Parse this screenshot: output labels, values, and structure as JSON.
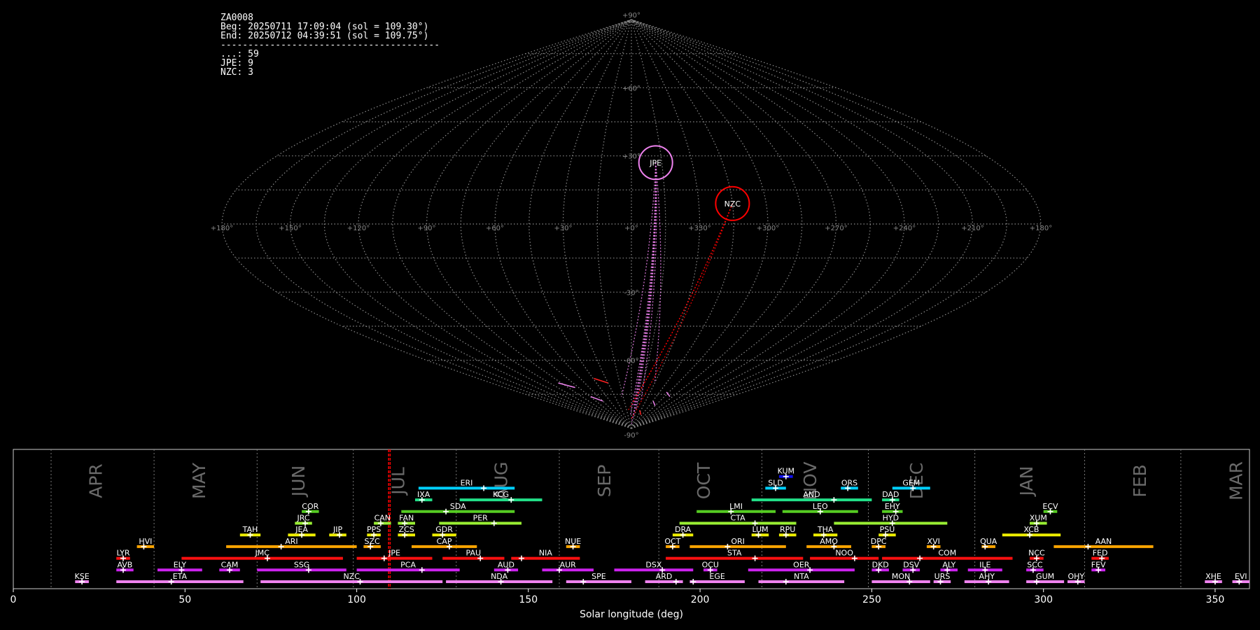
{
  "info_box": {
    "lines": [
      "ZA0008",
      "Beg: 20250711 17:09:04 (sol = 109.30°)",
      "End: 20250712 04:39:51 (sol = 109.75°)",
      "----------------------------------------",
      "...: 59",
      "JPE: 9",
      "NZC: 3"
    ]
  },
  "sky_map": {
    "projection": "sinusoidal",
    "lon_labels": [
      "+180°",
      "+150°",
      "+120°",
      "+90°",
      "+60°",
      "+30°",
      "+0°",
      "+330°",
      "+300°",
      "+270°",
      "+240°",
      "+210°",
      "+180°"
    ],
    "lat_labels": [
      "+90°",
      "+60°",
      "+30°",
      "-30°",
      "-60°",
      "-90°"
    ],
    "radiants": [
      {
        "name": "JPE",
        "color": "#ee82ee",
        "lon": -12,
        "lat": 27
      },
      {
        "name": "NZC",
        "color": "#ff0000",
        "lon": -45,
        "lat": 9
      }
    ]
  },
  "chart_data": {
    "type": "timeline",
    "xlabel": "Solar longitude (deg)",
    "xlim": [
      0,
      360
    ],
    "xticks": [
      0,
      50,
      100,
      150,
      200,
      250,
      300,
      350
    ],
    "months": [
      {
        "label": "APR",
        "boundary": 11,
        "center": 24
      },
      {
        "label": "MAY",
        "boundary": 41,
        "center": 54
      },
      {
        "label": "JUN",
        "boundary": 71,
        "center": 83
      },
      {
        "label": "JUL",
        "boundary": 99,
        "center": 112
      },
      {
        "label": "AUG",
        "boundary": 129,
        "center": 142
      },
      {
        "label": "SEP",
        "boundary": 159,
        "center": 172
      },
      {
        "label": "OCT",
        "boundary": 188,
        "center": 201
      },
      {
        "label": "NOV",
        "boundary": 218,
        "center": 232
      },
      {
        "label": "DEC",
        "boundary": 249,
        "center": 263
      },
      {
        "label": "JAN",
        "boundary": 280,
        "center": 295
      },
      {
        "label": "FEB",
        "boundary": 312,
        "center": 328
      },
      {
        "label": "MAR",
        "boundary": 340,
        "center": 356
      }
    ],
    "current": [
      109.3,
      109.75
    ],
    "showers": [
      {
        "name": "KUM",
        "start": 223,
        "end": 227,
        "peak": 225,
        "row": 9,
        "color": "#1010ee"
      },
      {
        "name": "ERI",
        "start": 118,
        "end": 146,
        "peak": 137,
        "row": 8,
        "color": "#00d0ff"
      },
      {
        "name": "SLD",
        "start": 219,
        "end": 225,
        "peak": 222,
        "row": 8,
        "color": "#00d0ff"
      },
      {
        "name": "ORS",
        "start": 241,
        "end": 246,
        "peak": 243,
        "row": 8,
        "color": "#00d0ff"
      },
      {
        "name": "GEM",
        "start": 256,
        "end": 267,
        "peak": 262,
        "row": 8,
        "color": "#00d0ff"
      },
      {
        "name": "IXA",
        "start": 117,
        "end": 122,
        "peak": 119,
        "row": 7,
        "color": "#22e088"
      },
      {
        "name": "KCG",
        "start": 130,
        "end": 154,
        "peak": 145,
        "row": 7,
        "color": "#22e088"
      },
      {
        "name": "AND",
        "start": 215,
        "end": 250,
        "peak": 239,
        "row": 7,
        "color": "#22e088"
      },
      {
        "name": "DAD",
        "start": 253,
        "end": 258,
        "peak": 256,
        "row": 7,
        "color": "#22e088"
      },
      {
        "name": "COR",
        "start": 84,
        "end": 89,
        "peak": 86,
        "row": 6,
        "color": "#55cc22"
      },
      {
        "name": "SDA",
        "start": 113,
        "end": 146,
        "peak": 126,
        "row": 6,
        "color": "#55cc22"
      },
      {
        "name": "LMI",
        "start": 199,
        "end": 222,
        "peak": 209,
        "row": 6,
        "color": "#55cc22"
      },
      {
        "name": "LEO",
        "start": 224,
        "end": 246,
        "peak": 235,
        "row": 6,
        "color": "#55cc22"
      },
      {
        "name": "EHY",
        "start": 253,
        "end": 259,
        "peak": 257,
        "row": 6,
        "color": "#55cc22"
      },
      {
        "name": "ECV",
        "start": 300,
        "end": 304,
        "peak": 302,
        "row": 6,
        "color": "#55cc22"
      },
      {
        "name": "JRC",
        "start": 82,
        "end": 87,
        "peak": 85,
        "row": 5,
        "color": "#99ee33"
      },
      {
        "name": "CAN",
        "start": 105,
        "end": 110,
        "peak": 107,
        "row": 5,
        "color": "#99ee33"
      },
      {
        "name": "FAN",
        "start": 112,
        "end": 117,
        "peak": 114,
        "row": 5,
        "color": "#99ee33"
      },
      {
        "name": "PER",
        "start": 124,
        "end": 148,
        "peak": 140,
        "row": 5,
        "color": "#99ee33"
      },
      {
        "name": "CTA",
        "start": 194,
        "end": 228,
        "peak": 216,
        "row": 5,
        "color": "#99ee33"
      },
      {
        "name": "HYD",
        "start": 239,
        "end": 272,
        "peak": 256,
        "row": 5,
        "color": "#99ee33"
      },
      {
        "name": "XUM",
        "start": 296,
        "end": 301,
        "peak": 298,
        "row": 5,
        "color": "#99ee33"
      },
      {
        "name": "TAH",
        "start": 66,
        "end": 72,
        "peak": 69,
        "row": 4,
        "color": "#eeee00"
      },
      {
        "name": "JEA",
        "start": 80,
        "end": 88,
        "peak": 84,
        "row": 4,
        "color": "#eeee00"
      },
      {
        "name": "JIP",
        "start": 92,
        "end": 97,
        "peak": 95,
        "row": 4,
        "color": "#eeee00"
      },
      {
        "name": "PPS",
        "start": 103,
        "end": 107,
        "peak": 105,
        "row": 4,
        "color": "#eeee00"
      },
      {
        "name": "ZCS",
        "start": 112,
        "end": 117,
        "peak": 114,
        "row": 4,
        "color": "#eeee00"
      },
      {
        "name": "GDR",
        "start": 122,
        "end": 129,
        "peak": 125,
        "row": 4,
        "color": "#eeee00"
      },
      {
        "name": "DRA",
        "start": 192,
        "end": 198,
        "peak": 195,
        "row": 4,
        "color": "#eeee00"
      },
      {
        "name": "LUM",
        "start": 215,
        "end": 220,
        "peak": 217,
        "row": 4,
        "color": "#eeee00"
      },
      {
        "name": "RPU",
        "start": 223,
        "end": 228,
        "peak": 225,
        "row": 4,
        "color": "#eeee00"
      },
      {
        "name": "THA",
        "start": 233,
        "end": 240,
        "peak": 236,
        "row": 4,
        "color": "#eeee00"
      },
      {
        "name": "PSU",
        "start": 252,
        "end": 257,
        "peak": 254,
        "row": 4,
        "color": "#eeee00"
      },
      {
        "name": "XCB",
        "start": 288,
        "end": 305,
        "peak": 296,
        "row": 4,
        "color": "#eeee00"
      },
      {
        "name": "HVI",
        "start": 36,
        "end": 41,
        "peak": 38,
        "row": 3,
        "color": "#ffa500"
      },
      {
        "name": "ARI",
        "start": 62,
        "end": 100,
        "peak": 78,
        "row": 3,
        "color": "#ffa500"
      },
      {
        "name": "SZC",
        "start": 102,
        "end": 107,
        "peak": 104,
        "row": 3,
        "color": "#ffa500"
      },
      {
        "name": "CAP",
        "start": 116,
        "end": 135,
        "peak": 127,
        "row": 3,
        "color": "#ffa500"
      },
      {
        "name": "NUE",
        "start": 161,
        "end": 165,
        "peak": 163,
        "row": 3,
        "color": "#ffa500"
      },
      {
        "name": "OCT",
        "start": 190,
        "end": 194,
        "peak": 192,
        "row": 3,
        "color": "#ffa500"
      },
      {
        "name": "ORI",
        "start": 197,
        "end": 225,
        "peak": 208,
        "row": 3,
        "color": "#ffa500"
      },
      {
        "name": "AMO",
        "start": 231,
        "end": 244,
        "peak": 239,
        "row": 3,
        "color": "#ffa500"
      },
      {
        "name": "DPC",
        "start": 250,
        "end": 254,
        "peak": 252,
        "row": 3,
        "color": "#ffa500"
      },
      {
        "name": "XVI",
        "start": 266,
        "end": 270,
        "peak": 268,
        "row": 3,
        "color": "#ffa500"
      },
      {
        "name": "QUA",
        "start": 282,
        "end": 286,
        "peak": 283,
        "row": 3,
        "color": "#ffa500"
      },
      {
        "name": "AAN",
        "start": 303,
        "end": 332,
        "peak": 313,
        "row": 3,
        "color": "#ffa500"
      },
      {
        "name": "LYR",
        "start": 30,
        "end": 34,
        "peak": 32,
        "row": 2,
        "color": "#ff1010"
      },
      {
        "name": "JMC",
        "start": 49,
        "end": 96,
        "peak": 74,
        "row": 2,
        "color": "#ff1010"
      },
      {
        "name": "JPE",
        "start": 100,
        "end": 122,
        "peak": 108,
        "row": 2,
        "color": "#ff1010"
      },
      {
        "name": "PAU",
        "start": 125,
        "end": 143,
        "peak": 136,
        "row": 2,
        "color": "#ff1010"
      },
      {
        "name": "NIA",
        "start": 145,
        "end": 165,
        "peak": 148,
        "row": 2,
        "color": "#ff1010"
      },
      {
        "name": "STA",
        "start": 190,
        "end": 230,
        "peak": 216,
        "row": 2,
        "color": "#ff1010"
      },
      {
        "name": "NOO",
        "start": 232,
        "end": 252,
        "peak": 245,
        "row": 2,
        "color": "#ff1010"
      },
      {
        "name": "COM",
        "start": 253,
        "end": 291,
        "peak": 264,
        "row": 2,
        "color": "#ff1010"
      },
      {
        "name": "NCC",
        "start": 296,
        "end": 300,
        "peak": 298,
        "row": 2,
        "color": "#ff1010"
      },
      {
        "name": "FED",
        "start": 314,
        "end": 319,
        "peak": 317,
        "row": 2,
        "color": "#ff1010"
      },
      {
        "name": "AVB",
        "start": 30,
        "end": 35,
        "peak": 32,
        "row": 1,
        "color": "#cc22ee"
      },
      {
        "name": "ELY",
        "start": 42,
        "end": 55,
        "peak": 49,
        "row": 1,
        "color": "#cc22ee"
      },
      {
        "name": "CAM",
        "start": 60,
        "end": 66,
        "peak": 63,
        "row": 1,
        "color": "#cc22ee"
      },
      {
        "name": "SSG",
        "start": 71,
        "end": 97,
        "peak": 86,
        "row": 1,
        "color": "#cc22ee"
      },
      {
        "name": "PCA",
        "start": 100,
        "end": 130,
        "peak": 119,
        "row": 1,
        "color": "#cc22ee"
      },
      {
        "name": "AUD",
        "start": 140,
        "end": 147,
        "peak": 144,
        "row": 1,
        "color": "#cc22ee"
      },
      {
        "name": "AUR",
        "start": 154,
        "end": 169,
        "peak": 159,
        "row": 1,
        "color": "#cc22ee"
      },
      {
        "name": "DSX",
        "start": 175,
        "end": 198,
        "peak": 189,
        "row": 1,
        "color": "#cc22ee"
      },
      {
        "name": "OCU",
        "start": 201,
        "end": 205,
        "peak": 203,
        "row": 1,
        "color": "#cc22ee"
      },
      {
        "name": "OER",
        "start": 214,
        "end": 245,
        "peak": 232,
        "row": 1,
        "color": "#cc22ee"
      },
      {
        "name": "DKD",
        "start": 250,
        "end": 255,
        "peak": 252,
        "row": 1,
        "color": "#cc22ee"
      },
      {
        "name": "DSV",
        "start": 259,
        "end": 264,
        "peak": 262,
        "row": 1,
        "color": "#cc22ee"
      },
      {
        "name": "ALY",
        "start": 270,
        "end": 275,
        "peak": 272,
        "row": 1,
        "color": "#cc22ee"
      },
      {
        "name": "ILE",
        "start": 278,
        "end": 288,
        "peak": 283,
        "row": 1,
        "color": "#cc22ee"
      },
      {
        "name": "SCC",
        "start": 295,
        "end": 300,
        "peak": 297,
        "row": 1,
        "color": "#cc22ee"
      },
      {
        "name": "FEV",
        "start": 314,
        "end": 318,
        "peak": 316,
        "row": 1,
        "color": "#cc22ee"
      },
      {
        "name": "KSE",
        "start": 18,
        "end": 22,
        "peak": 20,
        "row": 0,
        "color": "#ee82ee"
      },
      {
        "name": "ETA",
        "start": 30,
        "end": 67,
        "peak": 46,
        "row": 0,
        "color": "#ee82ee"
      },
      {
        "name": "NZC",
        "start": 72,
        "end": 125,
        "peak": 101,
        "row": 0,
        "color": "#ee82ee"
      },
      {
        "name": "NDA",
        "start": 126,
        "end": 157,
        "peak": 142,
        "row": 0,
        "color": "#ee82ee"
      },
      {
        "name": "SPE",
        "start": 161,
        "end": 180,
        "peak": 166,
        "row": 0,
        "color": "#ee82ee"
      },
      {
        "name": "ARD",
        "start": 184,
        "end": 195,
        "peak": 193,
        "row": 0,
        "color": "#ee82ee"
      },
      {
        "name": "EGE",
        "start": 197,
        "end": 213,
        "peak": 198,
        "row": 0,
        "color": "#ee82ee"
      },
      {
        "name": "NTA",
        "start": 217,
        "end": 242,
        "peak": 225,
        "row": 0,
        "color": "#ee82ee"
      },
      {
        "name": "MON",
        "start": 250,
        "end": 267,
        "peak": 261,
        "row": 0,
        "color": "#ee82ee"
      },
      {
        "name": "URS",
        "start": 268,
        "end": 273,
        "peak": 270,
        "row": 0,
        "color": "#ee82ee"
      },
      {
        "name": "AHY",
        "start": 277,
        "end": 290,
        "peak": 284,
        "row": 0,
        "color": "#ee82ee"
      },
      {
        "name": "GUM",
        "start": 295,
        "end": 306,
        "peak": 298,
        "row": 0,
        "color": "#ee82ee"
      },
      {
        "name": "OHY",
        "start": 307,
        "end": 312,
        "peak": 310,
        "row": 0,
        "color": "#ee82ee"
      },
      {
        "name": "XHE",
        "start": 347,
        "end": 352,
        "peak": 350,
        "row": 0,
        "color": "#ee82ee"
      },
      {
        "name": "EVI",
        "start": 355,
        "end": 360,
        "peak": 357,
        "row": 0,
        "color": "#ee82ee"
      }
    ]
  }
}
